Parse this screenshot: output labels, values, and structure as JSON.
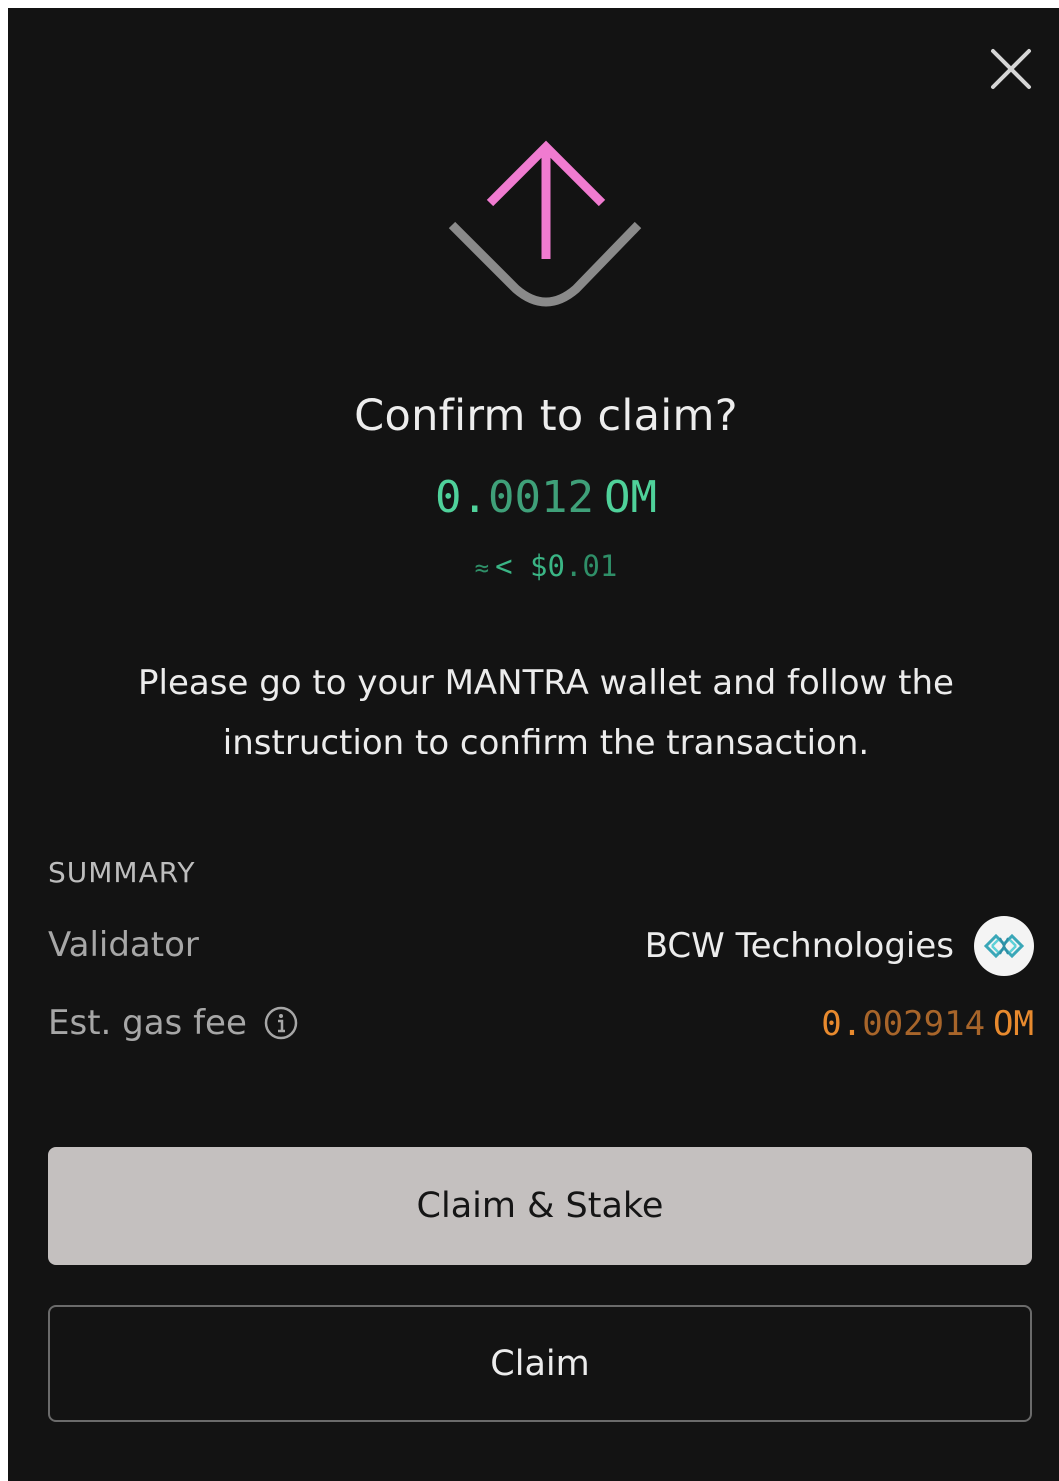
{
  "dialog": {
    "title": "Confirm to claim?",
    "amount": {
      "lead": "0.",
      "tail": "0012",
      "unit": "OM"
    },
    "usd": {
      "approx": "≈",
      "lead": "< $0",
      "tail": ".01"
    },
    "instruction": "Please go to your MANTRA wallet and follow the instruction to confirm the transaction.",
    "summary": {
      "heading": "SUMMARY",
      "validator_label": "Validator",
      "validator_name": "BCW Technologies",
      "gas_label": "Est. gas fee",
      "gas_lead": "0.",
      "gas_tail": "002914",
      "gas_unit": "OM"
    },
    "buttons": {
      "claim_stake": "Claim & Stake",
      "claim": "Claim"
    }
  },
  "icons": {
    "close": "close-icon",
    "hero": "claim-arrow-icon",
    "info": "info-icon",
    "validator_logo": "bcw-logo-icon"
  },
  "colors": {
    "background": "#131313",
    "accent_pink": "#f07bd0",
    "amount_green": "#4fd19a",
    "gas_orange": "#e88a2e",
    "primary_button": "#c4c0bf"
  }
}
